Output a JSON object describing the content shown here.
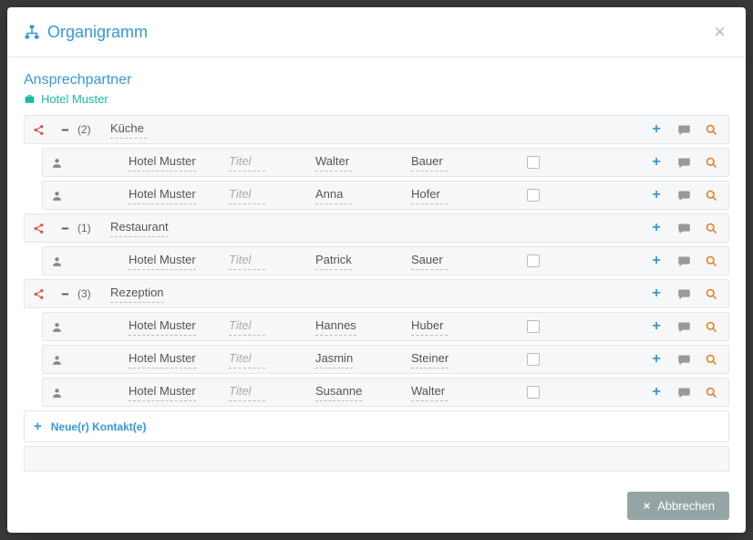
{
  "header": {
    "title": "Organigramm"
  },
  "section": {
    "title": "Ansprechpartner",
    "subtitle": "Hotel Muster"
  },
  "titlePlaceholder": "Titel",
  "groups": [
    {
      "count": "(2)",
      "name": "Küche",
      "contacts": [
        {
          "hotel": "Hotel Muster",
          "title": "",
          "first": "Walter",
          "last": "Bauer"
        },
        {
          "hotel": "Hotel Muster",
          "title": "",
          "first": "Anna",
          "last": "Hofer"
        }
      ]
    },
    {
      "count": "(1)",
      "name": "Restaurant",
      "contacts": [
        {
          "hotel": "Hotel Muster",
          "title": "",
          "first": "Patrick",
          "last": "Sauer"
        }
      ]
    },
    {
      "count": "(3)",
      "name": "Rezeption",
      "contacts": [
        {
          "hotel": "Hotel Muster",
          "title": "",
          "first": "Hannes",
          "last": "Huber"
        },
        {
          "hotel": "Hotel Muster",
          "title": "",
          "first": "Jasmin",
          "last": "Steiner"
        },
        {
          "hotel": "Hotel Muster",
          "title": "",
          "first": "Susanne",
          "last": "Walter"
        }
      ]
    }
  ],
  "newContact": "Neue(r) Kontakt(e)",
  "footer": {
    "cancel": "Abbrechen"
  }
}
